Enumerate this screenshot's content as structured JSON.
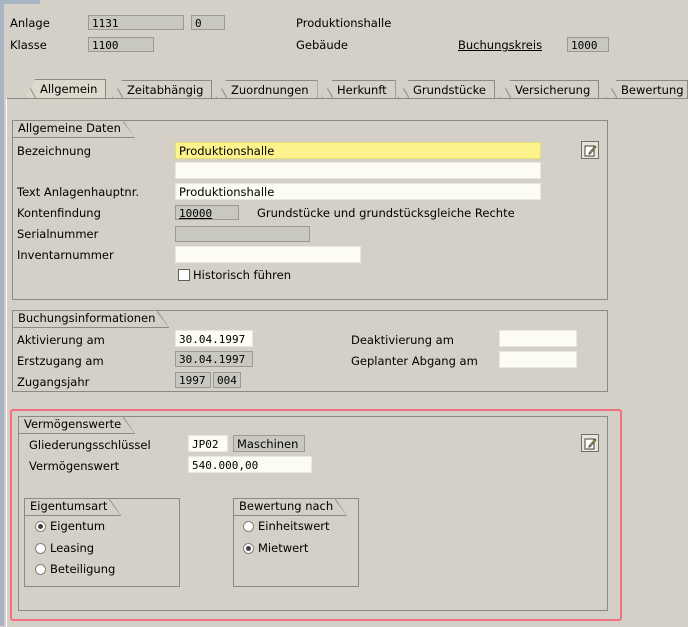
{
  "header": {
    "anlage_label": "Anlage",
    "anlage_value": "1131",
    "anlage_sub": "0",
    "anlage_desc": "Produktionshalle",
    "klasse_label": "Klasse",
    "klasse_value": "1100",
    "klasse_desc": "Gebäude",
    "buchungskreis_label": "Buchungskreis",
    "buchungskreis_value": "1000"
  },
  "tabs": [
    {
      "label": "Allgemein"
    },
    {
      "label": "Zeitabhängig"
    },
    {
      "label": "Zuordnungen"
    },
    {
      "label": "Herkunft"
    },
    {
      "label": "Grundstücke"
    },
    {
      "label": "Versicherung"
    },
    {
      "label": "Bewertung"
    }
  ],
  "allgemeine_daten": {
    "title": "Allgemeine Daten",
    "bezeichnung_label": "Bezeichnung",
    "bezeichnung_value": "Produktionshalle",
    "bezeichnung2_value": "",
    "text_label": "Text Anlagenhauptnr.",
    "text_value": "Produktionshalle",
    "kontenfindung_label": "Kontenfindung",
    "kontenfindung_value": "10000",
    "kontenfindung_desc": "Grundstücke und grundstücksgleiche Rechte",
    "serialnummer_label": "Serialnummer",
    "serialnummer_value": "",
    "inventarnummer_label": "Inventarnummer",
    "inventarnummer_value": "",
    "historisch_label": "Historisch führen",
    "historisch_checked": false
  },
  "buchungsinformationen": {
    "title": "Buchungsinformationen",
    "aktivierung_label": "Aktivierung am",
    "aktivierung_value": "30.04.1997",
    "erstzugang_label": "Erstzugang am",
    "erstzugang_value": "30.04.1997",
    "zugangsjahr_label": "Zugangsjahr",
    "zugangsjahr_year": "1997",
    "zugangsjahr_period": "004",
    "deaktivierung_label": "Deaktivierung am",
    "deaktivierung_value": "",
    "abgang_label": "Geplanter Abgang am",
    "abgang_value": ""
  },
  "vermoegenswerte": {
    "title": "Vermögenswerte",
    "gliederung_label": "Gliederungsschlüssel",
    "gliederung_value": "JP02",
    "gliederung_desc": "Maschinen",
    "vermoegenswert_label": "Vermögenswert",
    "vermoegenswert_value": "540.000,00",
    "eigentumsart": {
      "title": "Eigentumsart",
      "options": [
        "Eigentum",
        "Leasing",
        "Beteiligung"
      ],
      "selected": "Eigentum"
    },
    "bewertung": {
      "title": "Bewertung nach",
      "options": [
        "Einheitswert",
        "Mietwert"
      ],
      "selected": "Mietwert"
    }
  },
  "colors": {
    "background": "#d4d0c8",
    "highlight_border": "#f07080",
    "required_field": "#fdf38c",
    "input_field": "#fcfcf2",
    "readonly_field": "#c8c8c0"
  }
}
